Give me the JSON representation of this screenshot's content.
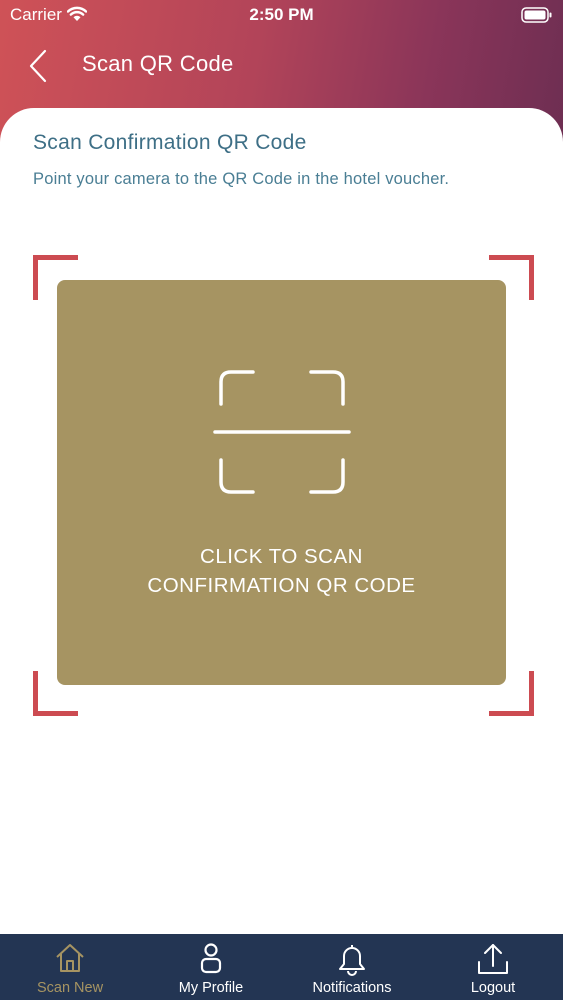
{
  "status_bar": {
    "carrier": "Carrier",
    "time": "2:50 PM"
  },
  "nav": {
    "title": "Scan QR Code"
  },
  "content": {
    "title": "Scan Confirmation QR Code",
    "subtitle": "Point your camera to the QR Code in the hotel voucher.",
    "scan_label_line1": "CLICK TO SCAN",
    "scan_label_line2": "CONFIRMATION QR CODE"
  },
  "tabs": [
    {
      "label": "Scan New",
      "icon": "home-icon",
      "active": true
    },
    {
      "label": "My Profile",
      "icon": "person-icon",
      "active": false
    },
    {
      "label": "Notifications",
      "icon": "bell-icon",
      "active": false
    },
    {
      "label": "Logout",
      "icon": "upload-icon",
      "active": false
    }
  ],
  "colors": {
    "accent_gold": "#a69462",
    "frame_red": "#cc4b51",
    "title_teal": "#3e6f86",
    "tab_bar_navy": "#233553"
  }
}
